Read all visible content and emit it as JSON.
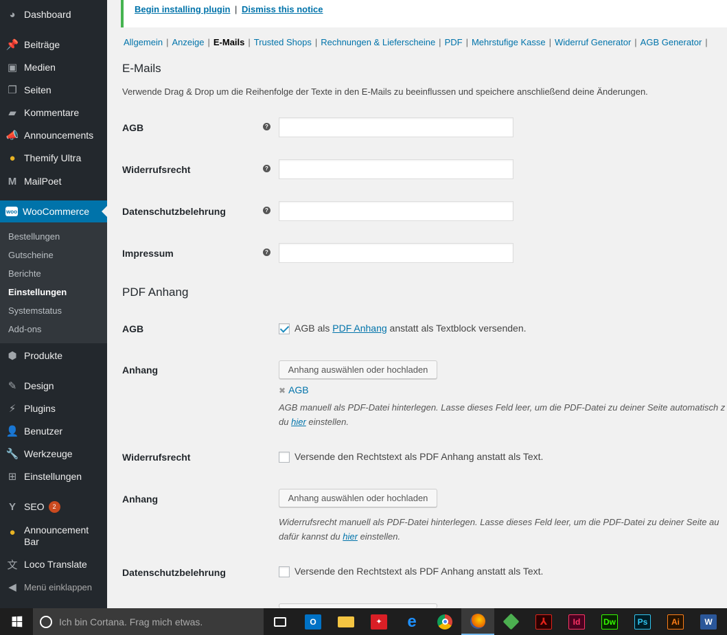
{
  "sidebar": {
    "dashboard": "Dashboard",
    "beitraege": "Beiträge",
    "medien": "Medien",
    "seiten": "Seiten",
    "kommentare": "Kommentare",
    "announcements": "Announcements",
    "themify": "Themify Ultra",
    "mailpoet": "MailPoet",
    "woocommerce": "WooCommerce",
    "woo_icon_text": "woo",
    "submenu": [
      "Bestellungen",
      "Gutscheine",
      "Berichte",
      "Einstellungen",
      "Systemstatus",
      "Add-ons"
    ],
    "produkte": "Produkte",
    "design": "Design",
    "plugins": "Plugins",
    "benutzer": "Benutzer",
    "werkzeuge": "Werkzeuge",
    "einstellungen": "Einstellungen",
    "seo": "SEO",
    "seo_badge": "2",
    "announcement_bar_1": "Announcement",
    "announcement_bar_2": "Bar",
    "loco": "Loco Translate",
    "collapse": "Menü einklappen"
  },
  "notice": {
    "install": "Begin installing plugin",
    "separator": "|",
    "dismiss": "Dismiss this notice"
  },
  "tabs": {
    "sep": "|",
    "t0": "Allgemein",
    "t1": "Anzeige",
    "t2": "E-Mails",
    "t3": "Trusted Shops",
    "t4": "Rechnungen & Lieferscheine",
    "t5": "PDF",
    "t6": "Mehrstufige Kasse",
    "t7": "Widerruf Generator",
    "t8": "AGB Generator"
  },
  "emails": {
    "title": "E-Mails",
    "intro": "Verwende Drag & Drop um die Reihenfolge der Texte in den E-Mails zu beeinflussen und speichere anschließend deine Änderungen.",
    "help": "?",
    "f_agb": "AGB",
    "f_widerruf": "Widerrufsrecht",
    "f_datenschutz": "Datenschutzbelehrung",
    "f_impressum": "Impressum"
  },
  "pdf": {
    "title": "PDF Anhang",
    "agb_label": "AGB",
    "agb_cb_pre": "AGB als",
    "agb_cb_link": "PDF Anhang",
    "agb_cb_post": "anstatt als Textblock versenden.",
    "anhang_label": "Anhang",
    "button": "Anhang auswählen oder hochladen",
    "remove": "✖",
    "attached": "AGB",
    "agb_desc_1": "AGB manuell als PDF-Datei hinterlegen. Lasse dieses Feld leer, um die PDF-Datei zu deiner Seite automatisch z",
    "agb_desc_2_pre": "du",
    "hier": "hier",
    "agb_desc_2_post": "einstellen.",
    "widerruf_label": "Widerrufsrecht",
    "cb_text": "Versende den Rechtstext als PDF Anhang anstatt als Text.",
    "widerruf_desc_1": "Widerrufsrecht manuell als PDF-Datei hinterlegen. Lasse dieses Feld leer, um die PDF-Datei zu deiner Seite au",
    "widerruf_desc_2_pre": "dafür kannst du",
    "widerruf_desc_2_post": "einstellen.",
    "datenschutz_label": "Datenschutzbelehrung"
  },
  "taskbar": {
    "search_placeholder": "Ich bin Cortana. Frag mich etwas.",
    "outlook": "O",
    "acrobat": "✦",
    "indesign": "Id",
    "dreamweaver": "Dw",
    "photoshop": "Ps",
    "illustrator": "Ai",
    "word": "W"
  },
  "colors": {
    "wp_blue": "#0073aa",
    "sidebar_bg": "#23282d",
    "notice_green": "#46b450",
    "badge": "#ca4a1f"
  }
}
